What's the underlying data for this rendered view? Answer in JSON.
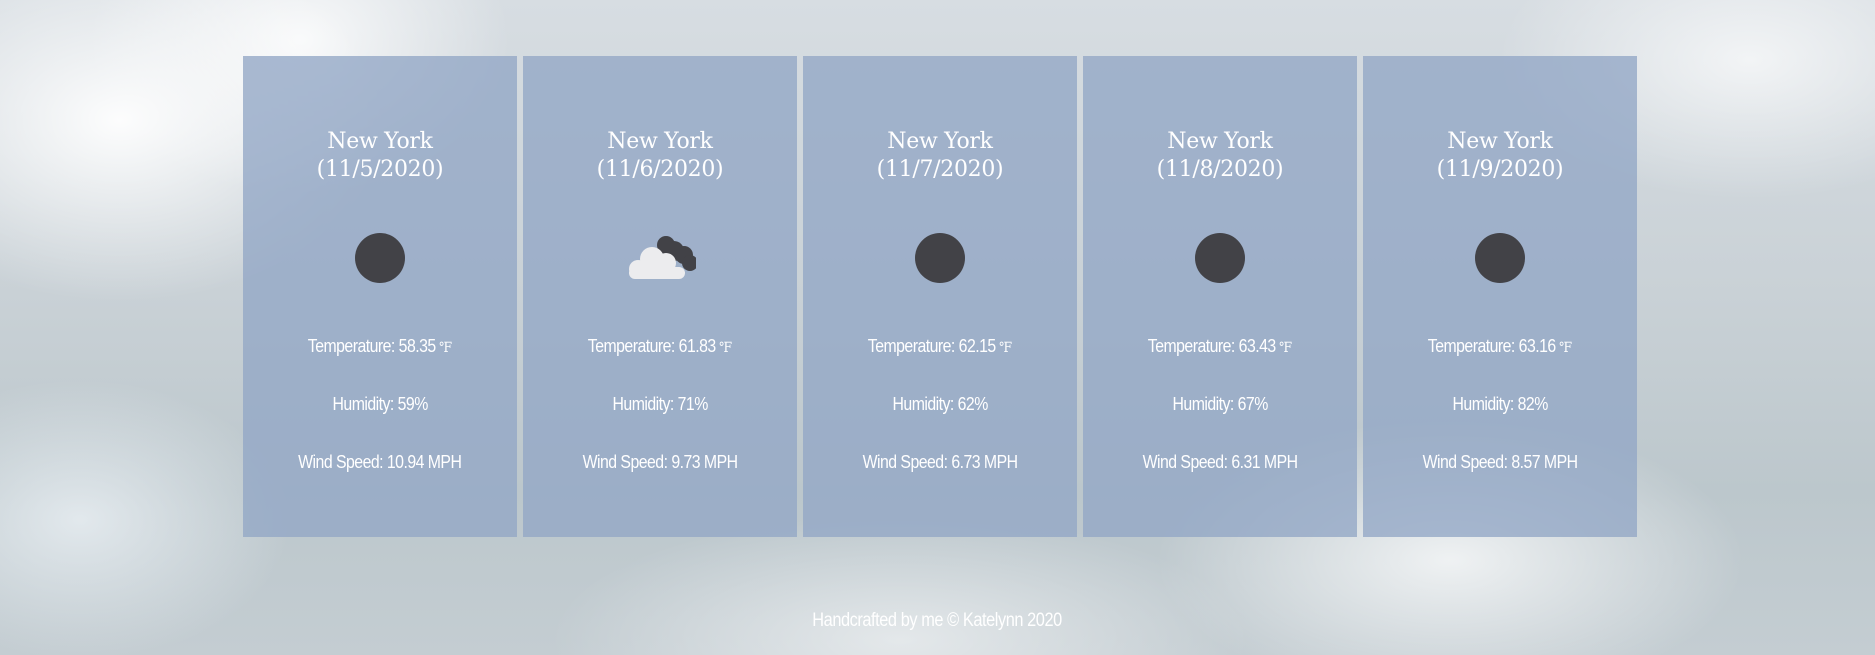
{
  "forecast": [
    {
      "city": "New York",
      "date": "(11/5/2020)",
      "icon": "dark-circle-icon",
      "temperature_label": "Temperature: 58.35",
      "unit": "℉",
      "humidity_label": "Humidity: 59%",
      "wind_label": "Wind Speed: 10.94 MPH"
    },
    {
      "city": "New York",
      "date": "(11/6/2020)",
      "icon": "partly-cloudy-icon",
      "temperature_label": "Temperature: 61.83",
      "unit": "℉",
      "humidity_label": "Humidity: 71%",
      "wind_label": "Wind Speed: 9.73 MPH"
    },
    {
      "city": "New York",
      "date": "(11/7/2020)",
      "icon": "dark-circle-icon",
      "temperature_label": "Temperature: 62.15",
      "unit": "℉",
      "humidity_label": "Humidity: 62%",
      "wind_label": "Wind Speed: 6.73 MPH"
    },
    {
      "city": "New York",
      "date": "(11/8/2020)",
      "icon": "dark-circle-icon",
      "temperature_label": "Temperature: 63.43",
      "unit": "℉",
      "humidity_label": "Humidity: 67%",
      "wind_label": "Wind Speed: 6.31 MPH"
    },
    {
      "city": "New York",
      "date": "(11/9/2020)",
      "icon": "dark-circle-icon",
      "temperature_label": "Temperature: 63.16",
      "unit": "℉",
      "humidity_label": "Humidity: 82%",
      "wind_label": "Wind Speed: 8.57 MPH"
    }
  ],
  "footer": {
    "text": "Handcrafted by me © Katelynn 2020"
  },
  "colors": {
    "card": "#92a6c5",
    "icon_dark": "#424247",
    "text": "#ffffff"
  }
}
